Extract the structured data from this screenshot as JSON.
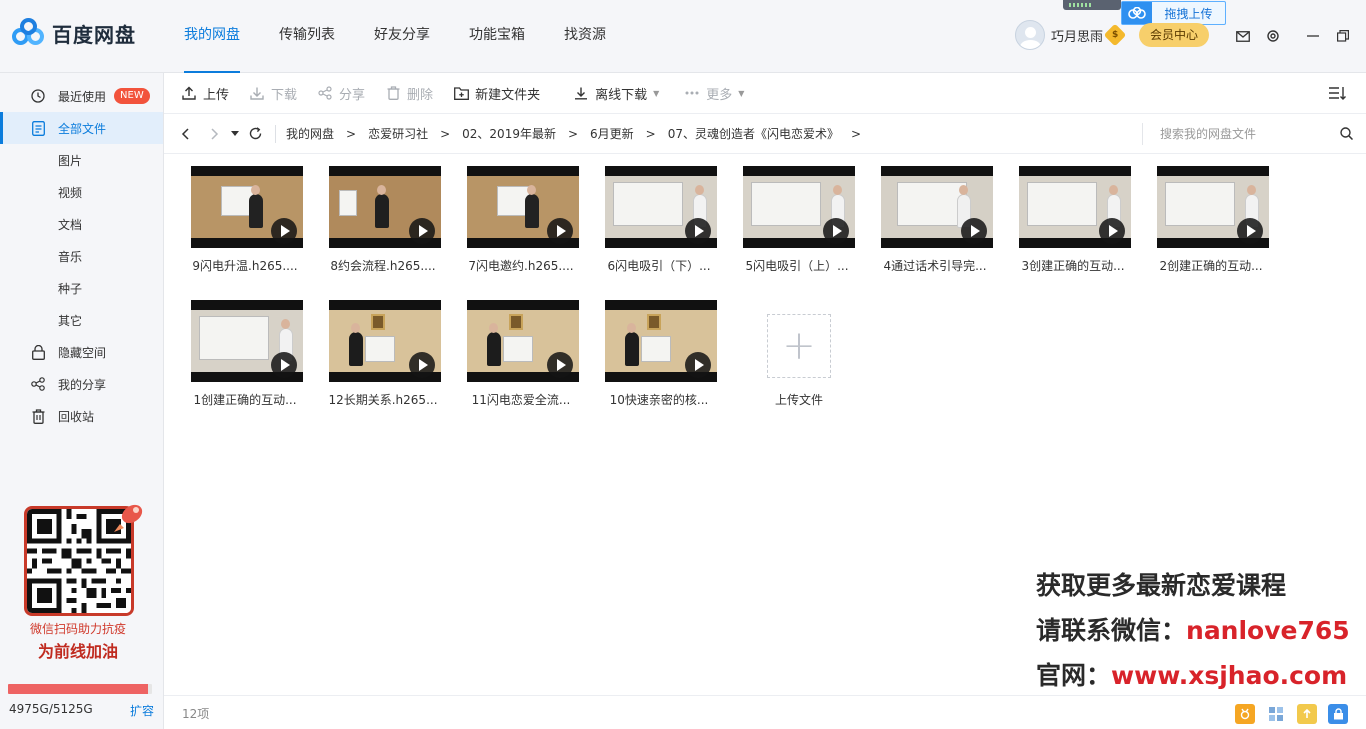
{
  "app": {
    "logo_text": "百度网盘"
  },
  "nav": {
    "tabs": [
      {
        "label": "我的网盘",
        "active": true
      },
      {
        "label": "传输列表"
      },
      {
        "label": "好友分享"
      },
      {
        "label": "功能宝箱"
      },
      {
        "label": "找资源"
      }
    ]
  },
  "user": {
    "name": "巧月思雨",
    "badge": "$",
    "vip_label": "会员中心"
  },
  "drag_upload": {
    "label": "拖拽上传"
  },
  "sidebar": {
    "items": [
      {
        "label": "最近使用",
        "badge": "NEW",
        "icon": "clock-icon"
      },
      {
        "label": "全部文件",
        "icon": "document-icon",
        "active": true
      },
      {
        "label": "图片"
      },
      {
        "label": "视频"
      },
      {
        "label": "文档"
      },
      {
        "label": "音乐"
      },
      {
        "label": "种子"
      },
      {
        "label": "其它"
      },
      {
        "label": "隐藏空间",
        "icon": "lock-icon"
      },
      {
        "label": "我的分享",
        "icon": "share-icon"
      },
      {
        "label": "回收站",
        "icon": "trash-icon"
      }
    ],
    "promo": {
      "line1": "微信扫码助力抗疫",
      "line2": "为前线加油"
    },
    "storage": {
      "text": "4975G/5125G",
      "used_fraction": 0.97,
      "expand": "扩容"
    }
  },
  "toolbar": {
    "upload": "上传",
    "download": "下载",
    "share": "分享",
    "delete": "删除",
    "new_folder": "新建文件夹",
    "offline_download": "离线下载",
    "more": "更多"
  },
  "path": {
    "crumbs": [
      "我的网盘",
      "恋爱研习社",
      "02、2019年最新",
      "6月更新",
      "07、灵魂创造者《闪电恋爱术》"
    ],
    "search_placeholder": "搜索我的网盘文件"
  },
  "files": [
    {
      "name": "9闪电升温.h265....",
      "scene": "person-board"
    },
    {
      "name": "8约会流程.h265....",
      "scene": "person-center"
    },
    {
      "name": "7闪电邀约.h265....",
      "scene": "person-board"
    },
    {
      "name": "6闪电吸引（下）...",
      "scene": "board-right"
    },
    {
      "name": "5闪电吸引（上）...",
      "scene": "board-right"
    },
    {
      "name": "4通过话术引导完...",
      "scene": "board-center"
    },
    {
      "name": "3创建正确的互动...",
      "scene": "board-right"
    },
    {
      "name": "2创建正确的互动...",
      "scene": "board-right"
    },
    {
      "name": "1创建正确的互动...",
      "scene": "board-right"
    },
    {
      "name": "12长期关系.h265...",
      "scene": "picture"
    },
    {
      "name": "11闪电恋爱全流...",
      "scene": "picture"
    },
    {
      "name": "10快速亲密的核...",
      "scene": "picture"
    }
  ],
  "upload_tile": {
    "label": "上传文件"
  },
  "watermark": {
    "line1": "获取更多最新恋爱课程",
    "line2_prefix": "请联系微信：",
    "line2_value": "nanlove765",
    "line3_prefix": "官网：",
    "line3_value": "www.xsjhao.com"
  },
  "status": {
    "count": "12项"
  }
}
